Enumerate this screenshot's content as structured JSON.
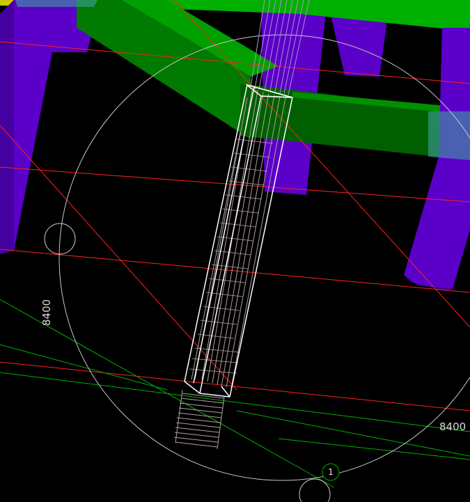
{
  "viewport": {
    "background": "#000000",
    "colors": {
      "beam_green": "#00a000",
      "beam_green_dark": "#006000",
      "column_purple": "#5a00c8",
      "column_purple_dark": "#3c0090",
      "gridline_red": "#ff2020",
      "gridline_green": "#00a000",
      "wireframe_white": "#ffffff",
      "rebar": "#b0a0a0",
      "selection_cyan": "#40a0a0",
      "yellow": "#c8c800"
    }
  },
  "annotations": {
    "dim_left": "8400",
    "dim_right": "8400",
    "grid_bubble": "1"
  }
}
